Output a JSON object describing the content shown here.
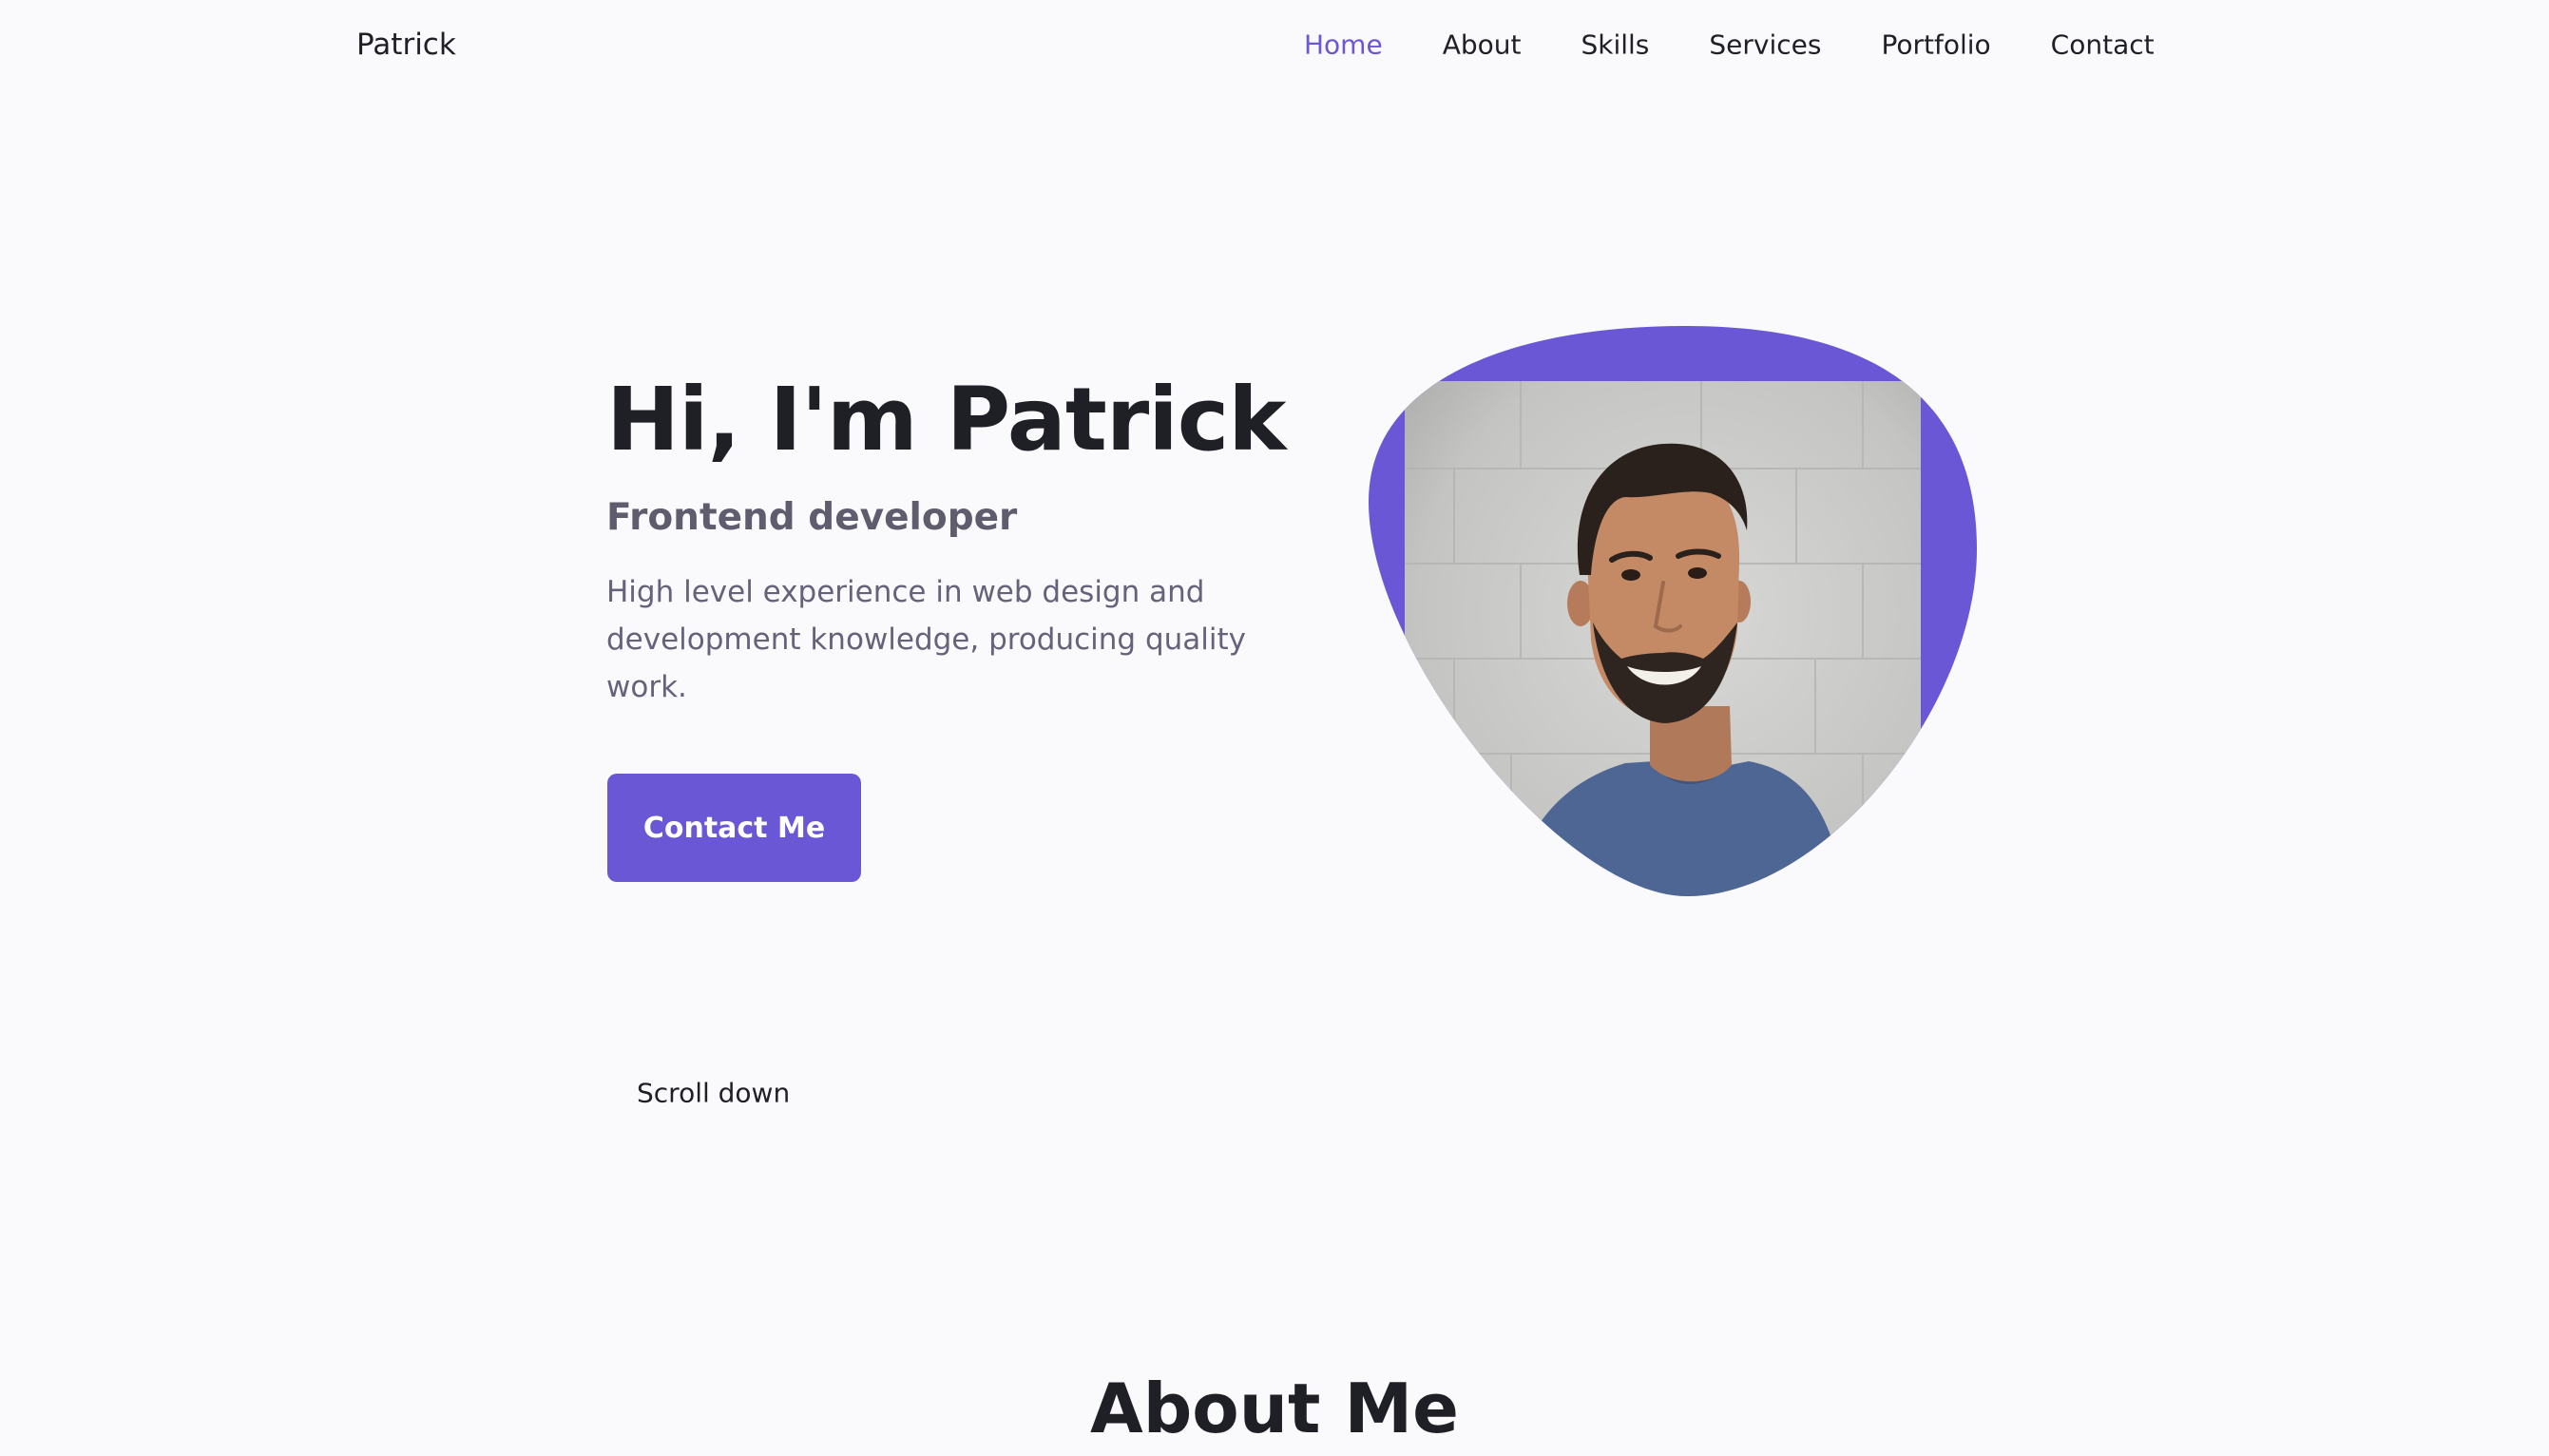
{
  "brand": {
    "name": "Patrick"
  },
  "nav": {
    "items": [
      {
        "label": "Home",
        "active": true
      },
      {
        "label": "About",
        "active": false
      },
      {
        "label": "Skills",
        "active": false
      },
      {
        "label": "Services",
        "active": false
      },
      {
        "label": "Portfolio",
        "active": false
      },
      {
        "label": "Contact",
        "active": false
      }
    ]
  },
  "hero": {
    "title": "Hi, I'm Patrick",
    "subtitle": "Frontend developer",
    "description": "High level experience in web design and development knowledge, producing quality work.",
    "button_label": "Contact Me"
  },
  "scroll": {
    "label": "Scroll down"
  },
  "about": {
    "title": "About Me"
  },
  "colors": {
    "accent": "#6a57d6",
    "background": "#fafafd",
    "text": "#1f1f26",
    "muted_text": "#66627a"
  }
}
